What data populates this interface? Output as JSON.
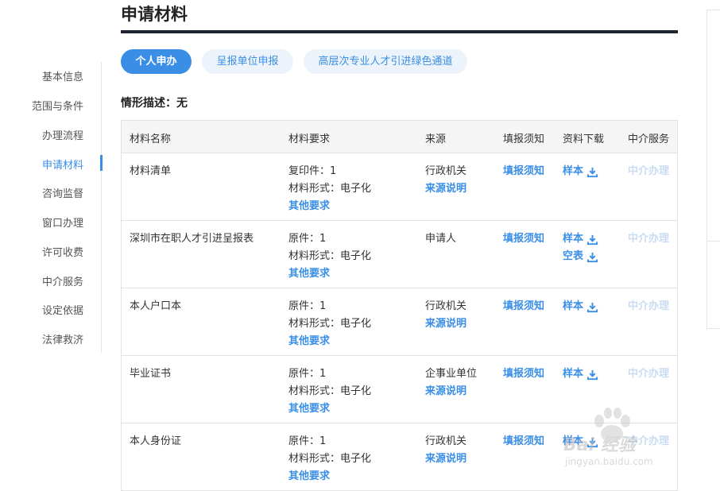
{
  "page": {
    "title": "申请材料",
    "description": "情形描述：无"
  },
  "sidebar": {
    "items": [
      {
        "label": "基本信息"
      },
      {
        "label": "范围与条件"
      },
      {
        "label": "办理流程"
      },
      {
        "label": "申请材料",
        "active": true
      },
      {
        "label": "咨询监督"
      },
      {
        "label": "窗口办理"
      },
      {
        "label": "许可收费"
      },
      {
        "label": "中介服务"
      },
      {
        "label": "设定依据"
      },
      {
        "label": "法律救济"
      }
    ]
  },
  "tabs": [
    {
      "label": "个人申办",
      "active": true
    },
    {
      "label": "呈报单位申报"
    },
    {
      "label": "高层次专业人才引进绿色通道"
    }
  ],
  "table": {
    "headers": [
      "材料名称",
      "材料要求",
      "来源",
      "填报须知",
      "资料下载",
      "中介服务"
    ],
    "rows": [
      {
        "name": "材料清单",
        "req1": "复印件：1",
        "req2": "材料形式：电子化",
        "req3": "其他要求",
        "source": "行政机关",
        "source_link": "来源说明",
        "notice": "填报须知",
        "downloads": [
          "样本"
        ],
        "agency": "中介办理"
      },
      {
        "name": "深圳市在职人才引进呈报表",
        "req1": "原件：1",
        "req2": "材料形式：电子化",
        "req3": "其他要求",
        "source": "申请人",
        "source_link": "",
        "notice": "填报须知",
        "downloads": [
          "样本",
          "空表"
        ],
        "agency": "中介办理"
      },
      {
        "name": "本人户口本",
        "req1": "原件：1",
        "req2": "材料形式：电子化",
        "req3": "其他要求",
        "source": "行政机关",
        "source_link": "来源说明",
        "notice": "填报须知",
        "downloads": [
          "样本"
        ],
        "agency": "中介办理"
      },
      {
        "name": "毕业证书",
        "req1": "原件：1",
        "req2": "材料形式：电子化",
        "req3": "其他要求",
        "source": "企事业单位",
        "source_link": "来源说明",
        "notice": "填报须知",
        "downloads": [
          "样本"
        ],
        "agency": "中介办理"
      },
      {
        "name": "本人身份证",
        "req1": "原件：1",
        "req2": "材料形式：电子化",
        "req3": "其他要求",
        "source": "行政机关",
        "source_link": "来源说明",
        "notice": "填报须知",
        "downloads": [
          "样本"
        ],
        "agency": "中介办理"
      }
    ]
  },
  "watermark": {
    "text": "Bai 经验",
    "sub": "jingyan.baidu.com"
  },
  "colors": {
    "accent": "#3a8ee6",
    "title_bar": "#1b2430",
    "disabled": "#c9dcf2"
  }
}
